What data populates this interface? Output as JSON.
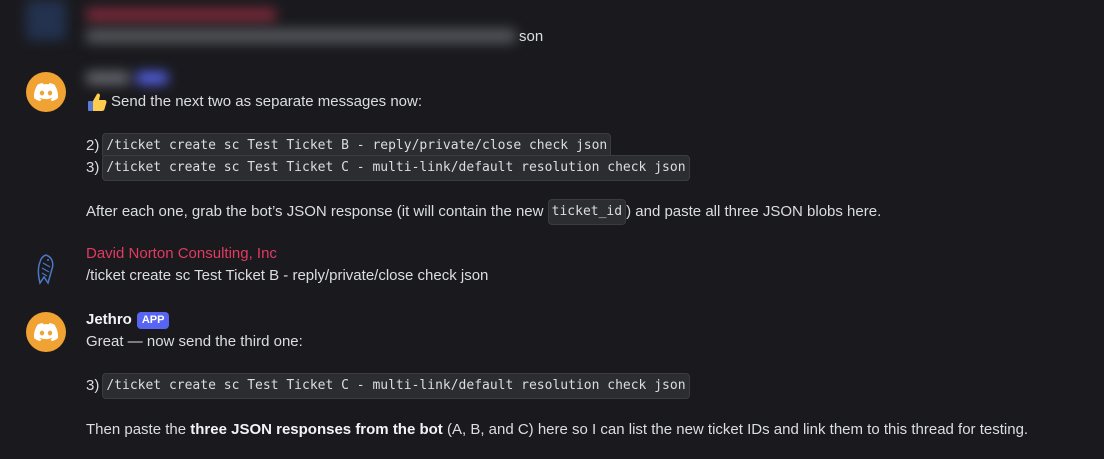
{
  "messages": [
    {
      "id": "prev_partial",
      "visible_suffix": "son"
    },
    {
      "id": "jethro_1",
      "lines": {
        "intro_emoji": "👍",
        "intro": "Send the next two as separate messages now:",
        "item2_num": "2)",
        "item2_code": "/ticket create sc Test Ticket B - reply/private/close check json",
        "item3_num": "3)",
        "item3_code": "/ticket create sc Test Ticket C - multi-link/default resolution check json",
        "after_pre": "After each one, grab the bot’s JSON response (it will contain the new ",
        "after_code": "ticket_id",
        "after_post": ") and paste all three JSON blobs here."
      }
    },
    {
      "id": "david_1",
      "username": "David Norton Consulting, Inc",
      "text": "/ticket create sc Test Ticket B - reply/private/close check json"
    },
    {
      "id": "jethro_2",
      "username": "Jethro",
      "badge": "APP",
      "lines": {
        "line1": "Great — now send the third one:",
        "item3_num": "3)",
        "item3_code": "/ticket create sc Test Ticket C - multi-link/default resolution check json",
        "then_pre": "Then paste the ",
        "then_bold": "three JSON responses from the bot",
        "then_post": " (A, B, and C) here so I can list the new ticket IDs and link them to this thread for testing."
      }
    }
  ],
  "colors": {
    "background": "#1a1a1e",
    "text": "#dbdee1",
    "username_red": "#e23a60",
    "badge": "#5865f2",
    "discord_avatar": "#f0a232"
  },
  "icons": {
    "bot_avatar": "discord-logo-icon",
    "david_avatar": "bird-logo-icon",
    "thumbs_up": "thumbs-up-emoji"
  }
}
